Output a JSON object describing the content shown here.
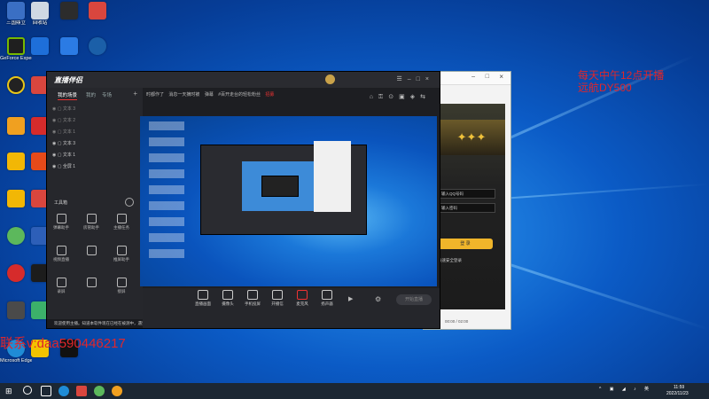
{
  "desktop_icons": [
    {
      "label": "三国鼎立",
      "color": "#3a6fc4"
    },
    {
      "label": "回收站",
      "color": "#cfd8e3"
    },
    {
      "label": "",
      "color": "#2c2c2c"
    },
    {
      "label": "",
      "color": "#d9463e"
    },
    {
      "label": "GeForce Experience",
      "color": "#1f1f1f"
    },
    {
      "label": "",
      "color": "#1e6fd9"
    },
    {
      "label": "",
      "color": "#2b7be4"
    },
    {
      "label": "",
      "color": "#1b5fa8"
    },
    {
      "label": "",
      "color": "#e8c619"
    },
    {
      "label": "",
      "color": "#d9463e"
    },
    {
      "label": "",
      "color": "#f0a020"
    },
    {
      "label": "",
      "color": "#d62b2b"
    },
    {
      "label": "",
      "color": "#f2b705"
    },
    {
      "label": "",
      "color": "#e64a19"
    },
    {
      "label": "",
      "color": "#5cb85c"
    },
    {
      "label": "",
      "color": "#2d5fb8"
    },
    {
      "label": "",
      "color": "#d62b2b"
    },
    {
      "label": "",
      "color": "#1c1c1c"
    },
    {
      "label": "",
      "color": "#4a4a4a"
    },
    {
      "label": "",
      "color": "#3cb06a"
    },
    {
      "label": "Microsoft Edge",
      "color": "#1f8cd6"
    },
    {
      "label": "",
      "color": "#f2c300"
    },
    {
      "label": "",
      "color": "#111111"
    }
  ],
  "overlay_text": {
    "top_right_line1": "每天中午12点开播",
    "top_right_line2": "远航DY500",
    "bottom_left": "联系v:daa590446217"
  },
  "main_app": {
    "logo": "直播伴侣",
    "title_menu": [
      "时都作了",
      "消息一天摘时被",
      "弹幕",
      "#百开走台的轻松粉丝",
      "招募"
    ],
    "sidebar_tabs": [
      "我的场景",
      "我的",
      "专场"
    ],
    "scenes": [
      "文本 3",
      "文本 2",
      "文本 1",
      "全屏 1"
    ],
    "tools_heading": "工具箱",
    "tools": [
      [
        "弹幕助手",
        "房管助手",
        "主播任务"
      ],
      [
        "视频直播",
        "",
        "推屏助手"
      ],
      [
        "录屏",
        "",
        "接屏"
      ],
      [
        "",
        "",
        ""
      ]
    ],
    "bottom_buttons": [
      "直播画面",
      "摄像头",
      "手机投屏",
      "开播信",
      "麦克风",
      "扬声器"
    ],
    "start_button": "开始直播",
    "notice": "欢迎使用主播。知道本软件现在已经在被测中，遇到问题请点击反馈",
    "status": "00:00 / 02:00"
  },
  "second_window": {
    "login_button": "登 录",
    "inputs": [
      "输入QQ号码",
      "输入密码"
    ],
    "footer": "快速安全登录",
    "status": "00:00 / 02:00"
  },
  "taskbar": {
    "time": "11:59",
    "date": "2022/11/23"
  }
}
